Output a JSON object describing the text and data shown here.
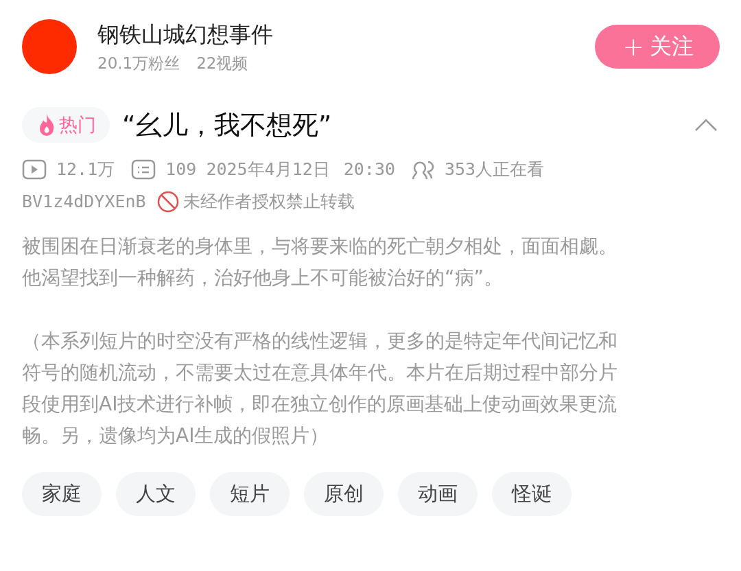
{
  "uploader": {
    "name": "钢铁山城幻想事件",
    "fans": "20.1万粉丝",
    "videos": "22视频",
    "follow_button": {
      "icon": "+",
      "label": "关注"
    }
  },
  "video": {
    "badge": "热门",
    "title": "“幺儿，我不想死”",
    "expanded": true,
    "stats": {
      "views": "12.1万",
      "comments": "109",
      "date": "2025年4月12日",
      "time": "20:30",
      "watching": "353人正在看"
    },
    "bvid": "BV1z4dDYXEnB",
    "copyright": "未经作者授权禁止转载",
    "description": [
      {
        "lines": [
          "被围困在日渐衰老的身体里，与将要来临的死亡朝夕相处，面面相觑。",
          "他渴望找到一种解药，治好他身上不可能被治好的“病”。"
        ]
      },
      {
        "lines": [
          "（本系列短片的时空没有严格的线性逻辑，更多的是特定年代间记忆和",
          "符号的随机流动，不需要太过在意具体年代。本片在后期过程中部分片",
          "段使用到AI技术进行补帧，即在独立创作的原画基础上使动画效果更流",
          "畅。另，遗像均为AI生成的假照片）"
        ]
      }
    ],
    "tags": [
      "家庭",
      "人文",
      "短片",
      "原创",
      "动画",
      "怪诞"
    ]
  }
}
